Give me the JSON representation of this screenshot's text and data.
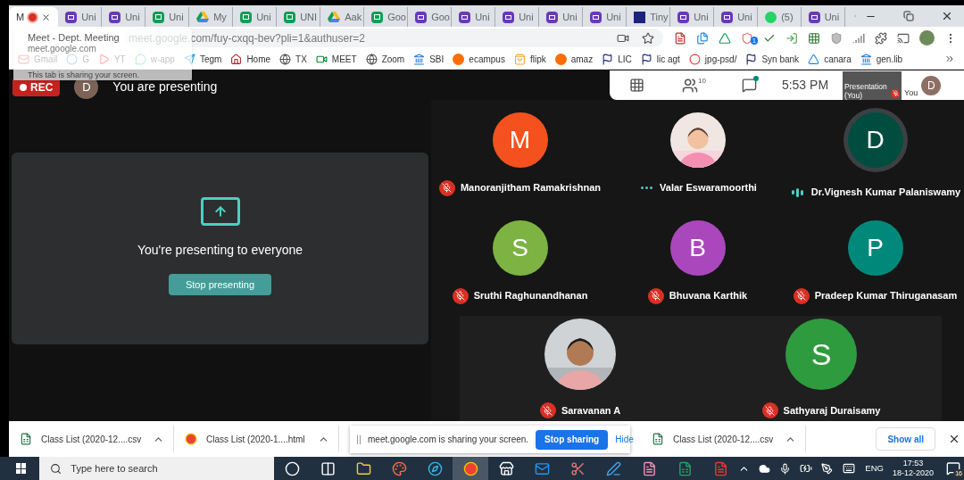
{
  "tabs": [
    {
      "title": "M",
      "kind": "meet",
      "selected": true,
      "recording": true
    },
    {
      "title": "Uni",
      "kind": "form",
      "selected": false
    },
    {
      "title": "Uni",
      "kind": "form",
      "selected": false
    },
    {
      "title": "Uni",
      "kind": "sheet",
      "selected": false
    },
    {
      "title": "My",
      "kind": "drive",
      "selected": false
    },
    {
      "title": "Uni",
      "kind": "sheet",
      "selected": false
    },
    {
      "title": "UNI",
      "kind": "sheet",
      "selected": false
    },
    {
      "title": "Aak",
      "kind": "drive",
      "selected": false
    },
    {
      "title": "Goo",
      "kind": "sheet",
      "selected": false
    },
    {
      "title": "Goo",
      "kind": "form",
      "selected": false
    },
    {
      "title": "Uni",
      "kind": "form",
      "selected": false
    },
    {
      "title": "Uni",
      "kind": "form",
      "selected": false
    },
    {
      "title": "Uni",
      "kind": "form",
      "selected": false
    },
    {
      "title": "Uni",
      "kind": "form",
      "selected": false
    },
    {
      "title": "Tiny",
      "kind": "tinyurl",
      "selected": false
    },
    {
      "title": "Uni",
      "kind": "form",
      "selected": false
    },
    {
      "title": "Uni",
      "kind": "form",
      "selected": false
    },
    {
      "title": "(5)",
      "kind": "whatsapp",
      "selected": false
    },
    {
      "title": "Uni",
      "kind": "form",
      "selected": false
    }
  ],
  "tab_hover_card": {
    "title": "Meet - Dept. Meeting",
    "domain": "meet.google.com",
    "note": "This tab is sharing your screen."
  },
  "address_bar": {
    "url": "meet.google.com/fuy-cxqq-bev?pli=1&authuser=2"
  },
  "extension_badge": "1",
  "bookmarks": [
    {
      "label": "Gmail",
      "kind": "mail"
    },
    {
      "label": "G",
      "kind": "google"
    },
    {
      "label": "YT",
      "kind": "video"
    },
    {
      "label": "w-app",
      "kind": "chat"
    },
    {
      "label": "Tegm",
      "kind": "send"
    },
    {
      "label": "Home",
      "kind": "home"
    },
    {
      "label": "TX",
      "kind": "globe"
    },
    {
      "label": "MEET",
      "kind": "camera"
    },
    {
      "label": "Zoom",
      "kind": "globe"
    },
    {
      "label": "SBI",
      "kind": "bank"
    },
    {
      "label": "ecampus",
      "kind": "letter"
    },
    {
      "label": "flipk",
      "kind": "bag"
    },
    {
      "label": "amaz",
      "kind": "letter"
    },
    {
      "label": "LIC",
      "kind": "flag"
    },
    {
      "label": "lic agt",
      "kind": "flag"
    },
    {
      "label": "jpg-psd/",
      "kind": "ring"
    },
    {
      "label": "Syn bank",
      "kind": "flag"
    },
    {
      "label": "canara",
      "kind": "triangle"
    },
    {
      "label": "gen.lib",
      "kind": "bank"
    }
  ],
  "meet": {
    "recording_label": "REC",
    "presenter_initial": "D",
    "presenting_text": "You are presenting",
    "participant_count": "10",
    "chat_unread": true,
    "time": "5:53 PM",
    "self_tile": {
      "label": "Presentation (You)",
      "muted": true
    },
    "self_label": "You",
    "self_initial": "D",
    "presentation_card": {
      "message": "You're presenting to everyone",
      "button": "Stop presenting"
    },
    "participants": [
      {
        "name": "Manoranjitham Ramakrishnan",
        "kind": "avatar",
        "initial": "M",
        "color": "#f4511e",
        "muted": true,
        "speaking": false
      },
      {
        "name": "Valar Eswaramoorthi",
        "kind": "picture",
        "muted": false,
        "speaking": false
      },
      {
        "name": "Dr.Vignesh Kumar Palaniswamy",
        "kind": "avatar",
        "initial": "D",
        "color": "#004d40",
        "muted": false,
        "speaking": true
      },
      {
        "name": "Sruthi Raghunandhanan",
        "kind": "avatar",
        "initial": "S",
        "color": "#7cb342",
        "muted": true,
        "speaking": false
      },
      {
        "name": "Bhuvana Karthik",
        "kind": "avatar",
        "initial": "B",
        "color": "#ab47bc",
        "muted": true,
        "speaking": false
      },
      {
        "name": "Pradeep Kumar Thiruganasam",
        "kind": "avatar",
        "initial": "P",
        "color": "#00897b",
        "muted": true,
        "speaking": false
      },
      {
        "name": "Saravanan A",
        "kind": "picture",
        "muted": true,
        "speaking": false
      },
      {
        "name": "Sathyaraj Duraisamy",
        "kind": "avatar",
        "initial": "S",
        "color": "#2e9b3e",
        "muted": true,
        "speaking": false
      }
    ]
  },
  "downloads": {
    "items": [
      {
        "name": "Class List (2020-12....csv",
        "kind": "csv"
      },
      {
        "name": "Class List (2020-1....html",
        "kind": "html"
      },
      {
        "name": "Class List (2020-12....csv",
        "kind": "csv"
      }
    ],
    "show_all": "Show all"
  },
  "share_notice": {
    "message": "meet.google.com is sharing your screen.",
    "stop": "Stop sharing",
    "hide": "Hide"
  },
  "taskbar": {
    "search_placeholder": "Type here to search",
    "apps": [
      {
        "kind": "cortana",
        "active": false
      },
      {
        "kind": "taskview",
        "active": false
      },
      {
        "kind": "folder",
        "active": false
      },
      {
        "kind": "paint",
        "active": false
      },
      {
        "kind": "edge",
        "active": false
      },
      {
        "kind": "chrome",
        "active": true
      },
      {
        "kind": "store",
        "active": false
      },
      {
        "kind": "mail",
        "active": false
      },
      {
        "kind": "snip",
        "active": false
      },
      {
        "kind": "whiteboard",
        "active": false
      },
      {
        "kind": "reader",
        "active": false
      },
      {
        "kind": "excel",
        "active": false
      },
      {
        "kind": "acrobat",
        "active": false
      }
    ],
    "language": "ENG",
    "time": "17:53",
    "date": "18-12-2020",
    "notifications": "16"
  }
}
